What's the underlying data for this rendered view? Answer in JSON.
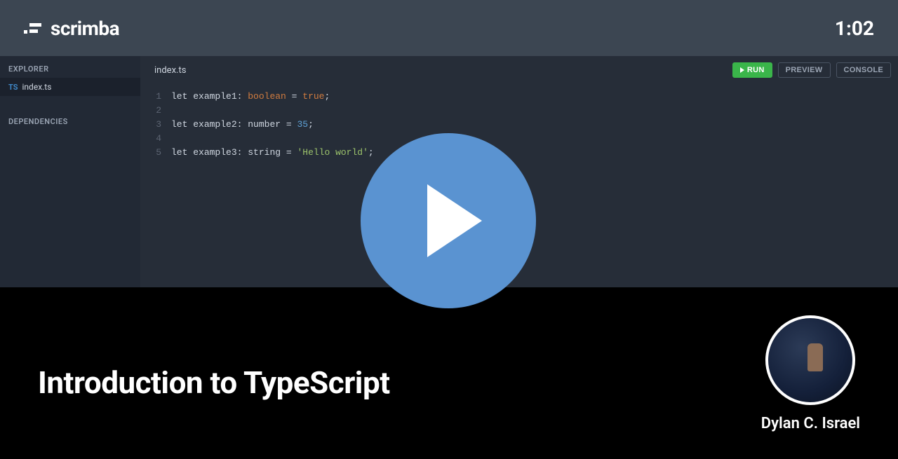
{
  "brand": {
    "name": "scrimba"
  },
  "timecode": "1:02",
  "sidebar": {
    "explorer_label": "EXPLORER",
    "dependencies_label": "DEPENDENCIES",
    "files": [
      {
        "lang_badge": "TS",
        "name": "index.ts"
      }
    ]
  },
  "editor": {
    "active_tab": "index.ts",
    "buttons": {
      "run": "RUN",
      "preview": "PREVIEW",
      "console": "CONSOLE"
    },
    "gutter": [
      "1",
      "2",
      "3",
      "4",
      "5"
    ],
    "code_lines": [
      {
        "kw": "let",
        "ident": "example1",
        "colon": ":",
        "type": "boolean",
        "type_class": "tok-type-bool",
        "eq": " = ",
        "value": "true",
        "value_class": "tok-true",
        "trail": ";"
      },
      null,
      {
        "kw": "let",
        "ident": "example2",
        "colon": ":",
        "type": "number",
        "type_class": "tok-type-num",
        "eq": " = ",
        "value": "35",
        "value_class": "tok-num",
        "trail": ";"
      },
      null,
      {
        "kw": "let",
        "ident": "example3",
        "colon": ":",
        "type": "string",
        "type_class": "tok-type-str",
        "eq": " = ",
        "value": "'Hello world'",
        "value_class": "tok-str",
        "trail": ";"
      }
    ]
  },
  "lesson": {
    "title": "Introduction to TypeScript",
    "author": "Dylan C. Israel"
  }
}
